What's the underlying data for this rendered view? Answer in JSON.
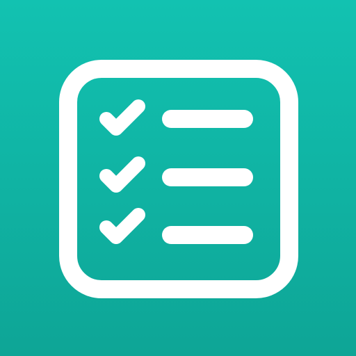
{
  "app_icon": {
    "name": "checklist-app-icon",
    "icon": "checklist-icon",
    "background_colors": [
      "#12c2b1",
      "#0ea596"
    ],
    "foreground_color": "#ffffff",
    "items": [
      {
        "checked": true,
        "icon": "checkmark-icon"
      },
      {
        "checked": true,
        "icon": "checkmark-icon"
      },
      {
        "checked": true,
        "icon": "checkmark-icon"
      }
    ]
  }
}
